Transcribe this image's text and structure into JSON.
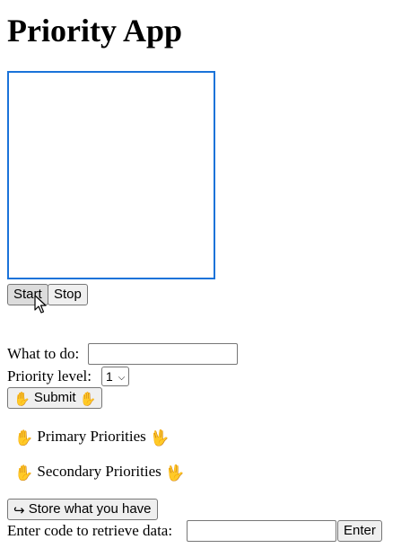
{
  "page": {
    "title": "Priority App"
  },
  "controls": {
    "start_label": "Start",
    "stop_label": "Stop"
  },
  "form": {
    "task_label": "What to do:",
    "task_value": "",
    "priority_label": "Priority level:",
    "priority_value": "1",
    "submit_label": "Submit"
  },
  "lists": {
    "primary_label": "Primary Priorities",
    "secondary_label": "Secondary Priorities"
  },
  "storage": {
    "store_label": "Store what you have",
    "retrieve_label": "Enter code to retrieve data:",
    "code_value": "",
    "enter_label": "Enter"
  },
  "colors": {
    "video_border": "#1a73d9"
  },
  "icons": [
    "raised-hand-icon",
    "vulcan-salute-icon",
    "right-hook-arrow-icon",
    "mouse-pointer-icon"
  ]
}
